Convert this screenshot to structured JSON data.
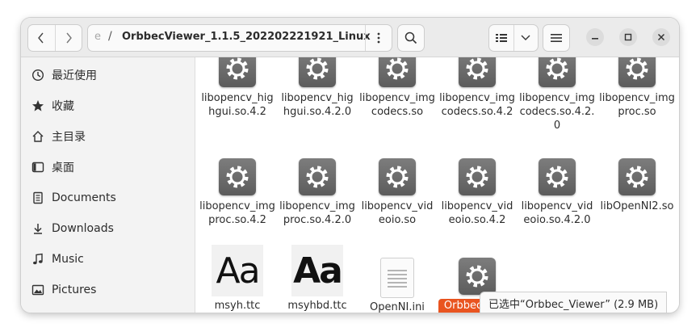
{
  "path": {
    "previous": "e",
    "separator": "/",
    "current": "OrbbecViewer_1.1.5_202202221921_Linux"
  },
  "sidebar": {
    "items": [
      {
        "label": "最近使用",
        "icon": "clock-icon"
      },
      {
        "label": "收藏",
        "icon": "star-icon"
      },
      {
        "label": "主目录",
        "icon": "home-icon"
      },
      {
        "label": "桌面",
        "icon": "desktop-icon"
      },
      {
        "label": "Documents",
        "icon": "document-icon"
      },
      {
        "label": "Downloads",
        "icon": "download-icon"
      },
      {
        "label": "Music",
        "icon": "music-icon"
      },
      {
        "label": "Pictures",
        "icon": "picture-icon"
      }
    ]
  },
  "files": [
    {
      "name": "libopencv_highgui.so.4.2",
      "type": "gear-icon"
    },
    {
      "name": "libopencv_highgui.so.4.2.0",
      "type": "gear-icon"
    },
    {
      "name": "libopencv_imgcodecs.so",
      "type": "gear-icon"
    },
    {
      "name": "libopencv_imgcodecs.so.4.2",
      "type": "gear-icon"
    },
    {
      "name": "libopencv_imgcodecs.so.4.2.0",
      "type": "gear-icon"
    },
    {
      "name": "libopencv_imgproc.so",
      "type": "gear-icon"
    },
    {
      "name": "libopencv_imgproc.so.4.2",
      "type": "gear-icon"
    },
    {
      "name": "libopencv_imgproc.so.4.2.0",
      "type": "gear-icon"
    },
    {
      "name": "libopencv_videoio.so",
      "type": "gear-icon"
    },
    {
      "name": "libopencv_videoio.so.4.2",
      "type": "gear-icon"
    },
    {
      "name": "libopencv_videoio.so.4.2.0",
      "type": "gear-icon"
    },
    {
      "name": "libOpenNI2.so",
      "type": "gear-icon"
    },
    {
      "name": "msyh.ttc",
      "type": "font-icon",
      "preview": "Aa"
    },
    {
      "name": "msyhbd.ttc",
      "type": "font-icon-bold",
      "preview": "Aa"
    },
    {
      "name": "OpenNI.ini",
      "type": "text-file-icon"
    },
    {
      "name": "Orbbec_Viewer",
      "type": "gear-icon",
      "selected": true,
      "visible_label": "Orbbec Viewer"
    }
  ],
  "status": {
    "text": "已选中“Orbbec_Viewer” (2.9 MB)"
  },
  "colors": {
    "selection": "#e95420",
    "headerbar": "#ebebeb",
    "sidebar": "#f3f3f3"
  }
}
